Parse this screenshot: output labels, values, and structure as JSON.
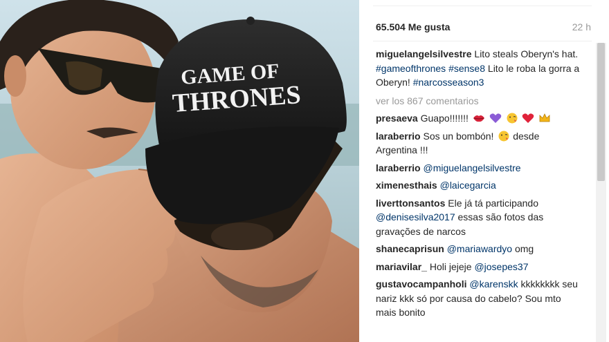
{
  "photo": {
    "cap_text_line1": "GAME OF",
    "cap_text_line2": "THRONES"
  },
  "header": {
    "likes": "65.504 Me gusta",
    "age": "22 h"
  },
  "caption": {
    "user": "miguelangelsilvestre",
    "text1": "Lito steals Oberyn's hat.",
    "tag1": "#gameofthrones",
    "tag2": "#sense8",
    "text2": "Lito le roba la gorra a Oberyn!",
    "tag3": "#narcosseason3"
  },
  "view_comments": "ver los 867 comentarios",
  "comments": [
    {
      "user": "presaeva",
      "text": "Guapo!!!!!!!",
      "emojis": [
        "lips-icon",
        "purple-heart-icon",
        "kiss-face-icon",
        "red-heart-icon",
        "crown-icon"
      ]
    },
    {
      "user": "laraberrio",
      "text": "Sos un bombón!",
      "text2": "desde Argentina !!!"
    },
    {
      "user": "laraberrio",
      "mention": "@miguelangelsilvestre"
    },
    {
      "user": "ximenesthais",
      "mention": "@laicegarcia"
    },
    {
      "user": "liverttonsantos",
      "text": "Ele já tá participando",
      "mention": "@denisesilva2017",
      "text2": "essas são fotos das gravações de narcos"
    },
    {
      "user": "shanecaprisun",
      "mention": "@mariawardyo",
      "text2": "omg"
    },
    {
      "user": "mariavilar_",
      "text": "Holi jejeje",
      "mention": "@josepes37"
    },
    {
      "user": "gustavocampanholi",
      "mention": "@karenskk",
      "text2": "kkkkkkkk seu nariz kkk só por causa do cabelo? Sou mto mais bonito"
    }
  ]
}
